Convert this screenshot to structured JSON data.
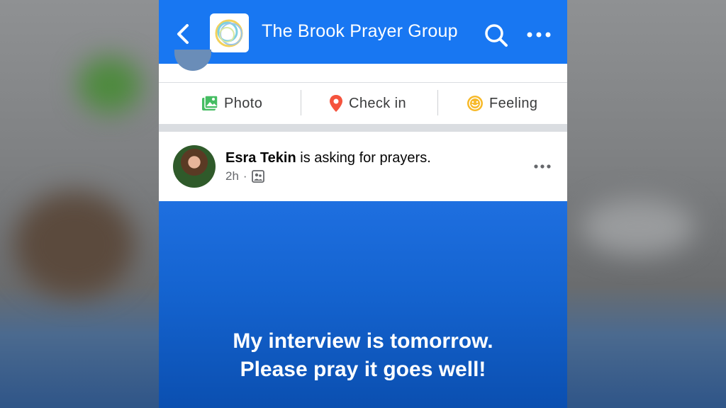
{
  "header": {
    "group_title": "The Brook Prayer Group",
    "back_icon": "chevron-left-icon",
    "search_icon": "search-icon",
    "more_icon": "more-horizontal-icon",
    "bar_color": "#1877f2"
  },
  "composer_actions": [
    {
      "label": "Photo",
      "icon": "photo-icon",
      "color": "#45bd62"
    },
    {
      "label": "Check in",
      "icon": "location-pin-icon",
      "color": "#f5533d"
    },
    {
      "label": "Feeling",
      "icon": "smiley-icon",
      "color": "#f7b928"
    }
  ],
  "post": {
    "author": "Esra Tekin",
    "action_text": " is asking for prayers.",
    "time": "2h",
    "audience_icon": "group-audience-icon",
    "text_line1": "My interview is tomorrow.",
    "text_line2": "Please pray it goes well!",
    "background_color": "#1463cf"
  }
}
